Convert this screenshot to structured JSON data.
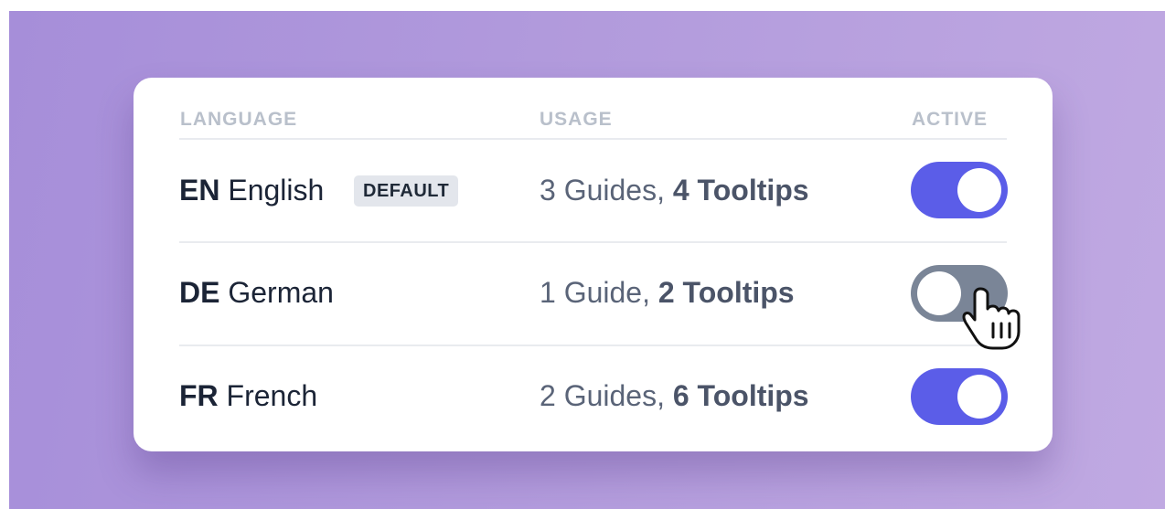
{
  "table": {
    "headers": {
      "language": "LANGUAGE",
      "usage": "USAGE",
      "active": "ACTIVE"
    },
    "rows": [
      {
        "code": "EN",
        "name": "English",
        "badge": "DEFAULT",
        "guides": "3 Guides,",
        "tooltips": "4 Tooltips",
        "active": true
      },
      {
        "code": "DE",
        "name": "German",
        "guides": "1 Guide,",
        "tooltips": "2 Tooltips",
        "active": false
      },
      {
        "code": "FR",
        "name": "French",
        "guides": "2 Guides,",
        "tooltips": "6 Tooltips",
        "active": true
      }
    ]
  },
  "colors": {
    "toggle_on": "#5b5de8",
    "toggle_off": "#7a8597",
    "background": "#b49ddd"
  },
  "icons": {
    "cursor": "hand-pointer-icon"
  }
}
